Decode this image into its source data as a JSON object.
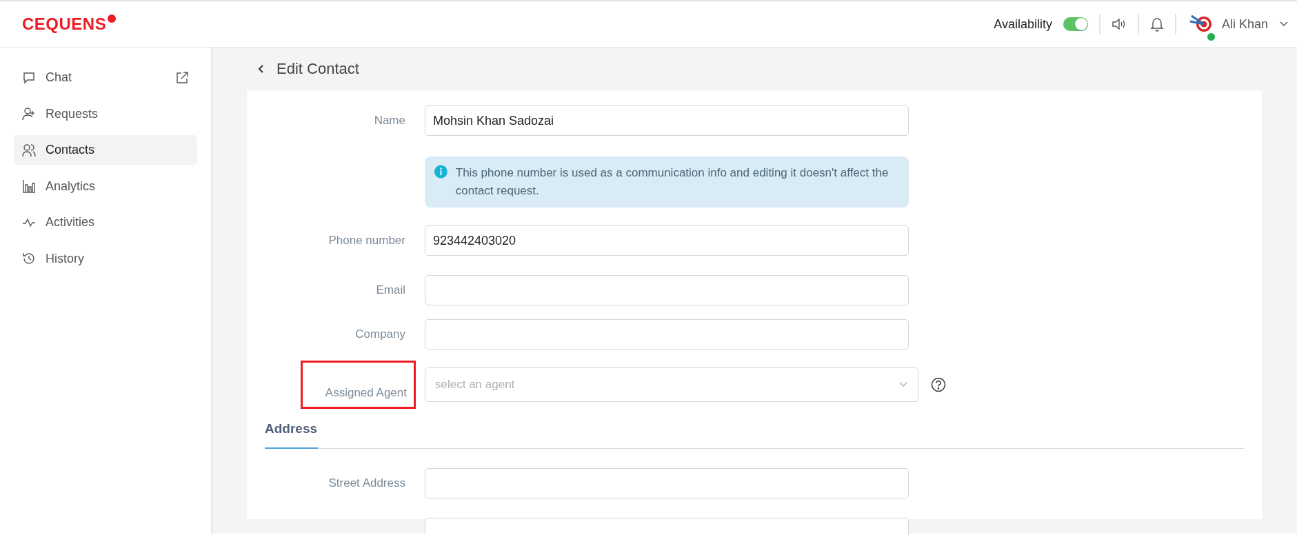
{
  "header": {
    "logo": "CEQUENS",
    "availability": {
      "label": "Availability",
      "on": true
    },
    "user": {
      "name": "Ali Khan",
      "online": true
    }
  },
  "sidebar": {
    "items": [
      {
        "label": "Chat",
        "kind": "chat",
        "selected": false,
        "external": true
      },
      {
        "label": "Requests",
        "kind": "requests",
        "selected": false,
        "external": false
      },
      {
        "label": "Contacts",
        "kind": "contacts",
        "selected": true,
        "external": false
      },
      {
        "label": "Analytics",
        "kind": "analytics",
        "selected": false,
        "external": false
      },
      {
        "label": "Activities",
        "kind": "activities",
        "selected": false,
        "external": false
      },
      {
        "label": "History",
        "kind": "history",
        "selected": false,
        "external": false
      }
    ]
  },
  "page": {
    "title": "Edit Contact"
  },
  "fields": [
    {
      "kind": "input",
      "label": "Name",
      "value": "Mohsin Khan Sadozai",
      "highlighted": false
    },
    {
      "kind": "info",
      "text": "This phone number is used as a communication info and editing it doesn't affect the contact request."
    },
    {
      "kind": "input",
      "label": "Phone number",
      "value": "923442403020",
      "highlighted": false
    },
    {
      "kind": "input",
      "label": "Email",
      "highlighted": false
    },
    {
      "kind": "input",
      "label": "Company",
      "highlighted": false
    },
    {
      "kind": "select",
      "label": "Assigned Agent",
      "placeholder": "select an agent",
      "highlighted": true
    }
  ],
  "address": {
    "tab": "Address",
    "fields": [
      {
        "kind": "input",
        "label": "Street Address"
      },
      {
        "kind": "input"
      }
    ]
  }
}
